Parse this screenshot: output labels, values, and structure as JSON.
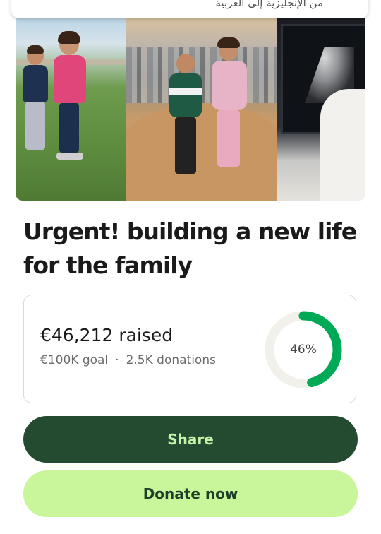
{
  "translate_banner": {
    "text": "من الإنجليزية إلى العربية"
  },
  "photos": [
    {
      "name": "two children standing on grass"
    },
    {
      "name": "two children standing on sand mound in front of tents"
    },
    {
      "name": "ultrasound monitor"
    }
  ],
  "campaign": {
    "title": "Urgent! building a new life for the family"
  },
  "progress": {
    "raised_text": "€46,212 raised",
    "goal_text": "€100K goal",
    "separator": "·",
    "donations_text": "2.5K donations",
    "percent": 46,
    "percent_label": "46%"
  },
  "actions": {
    "share_label": "Share",
    "donate_label": "Donate now"
  },
  "colors": {
    "progress_ring": "#00a956",
    "progress_track": "#f1f0ea",
    "share_bg": "#244b30",
    "share_text": "#c9f2a9",
    "donate_bg": "#c9f59b",
    "donate_text": "#1d3f27"
  }
}
